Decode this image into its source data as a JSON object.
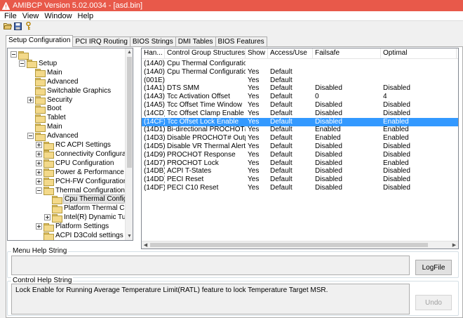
{
  "window": {
    "title": "AMIBCP Version 5.02.0034 - [asd.bin]"
  },
  "menu": [
    "File",
    "View",
    "Window",
    "Help"
  ],
  "toolbar": {
    "open_icon": "folder-open-icon",
    "save_icon": "save-icon",
    "help_icon": "key-icon"
  },
  "tabs": [
    "Setup Configuration",
    "PCI IRQ Routing",
    "BIOS Strings",
    "DMI Tables",
    "BIOS Features"
  ],
  "tree": [
    {
      "label": "",
      "level": 0,
      "exp": "minus"
    },
    {
      "label": "Setup",
      "level": 1,
      "exp": "minus"
    },
    {
      "label": "Main",
      "level": 2,
      "exp": "none"
    },
    {
      "label": "Advanced",
      "level": 2,
      "exp": "none"
    },
    {
      "label": "Switchable Graphics",
      "level": 2,
      "exp": "none"
    },
    {
      "label": "Security",
      "level": 2,
      "exp": "plus"
    },
    {
      "label": "Boot",
      "level": 2,
      "exp": "none"
    },
    {
      "label": "Tablet",
      "level": 2,
      "exp": "none"
    },
    {
      "label": "Main",
      "level": 2,
      "exp": "none"
    },
    {
      "label": "Advanced",
      "level": 2,
      "exp": "minus"
    },
    {
      "label": "RC ACPI Settings",
      "level": 3,
      "exp": "plus"
    },
    {
      "label": "Connectivity Configuration",
      "level": 3,
      "exp": "plus"
    },
    {
      "label": "CPU Configuration",
      "level": 3,
      "exp": "plus"
    },
    {
      "label": "Power & Performance",
      "level": 3,
      "exp": "plus"
    },
    {
      "label": "PCH-FW Configuration",
      "level": 3,
      "exp": "plus"
    },
    {
      "label": "Thermal Configuration",
      "level": 3,
      "exp": "minus"
    },
    {
      "label": "Cpu Thermal Configurat",
      "level": 4,
      "exp": "none",
      "selected": true
    },
    {
      "label": "Platform Thermal Config",
      "level": 4,
      "exp": "none"
    },
    {
      "label": "Intel(R) Dynamic Tuning",
      "level": 4,
      "exp": "plus"
    },
    {
      "label": "Platform Settings",
      "level": 3,
      "exp": "plus"
    },
    {
      "label": "ACPI D3Cold settings",
      "level": 3,
      "exp": "none"
    }
  ],
  "grid": {
    "columns": [
      "Han...",
      "Control Group Structures",
      "Show",
      "Access/Use",
      "Failsafe",
      "Optimal"
    ],
    "rows": [
      [
        "(14A0)",
        "Cpu Thermal Configuration",
        "",
        "",
        "",
        ""
      ],
      [
        "(14A0)",
        "Cpu Thermal Configuration",
        "Yes",
        "Default",
        "",
        ""
      ],
      [
        "(001E)",
        "",
        "Yes",
        "Default",
        "",
        ""
      ],
      [
        "(14A1)",
        "DTS SMM",
        "Yes",
        "Default",
        "Disabled",
        "Disabled"
      ],
      [
        "(14A3)",
        "Tcc Activation Offset",
        "Yes",
        "Default",
        "0",
        "4"
      ],
      [
        "(14A5)",
        "Tcc Offset Time Window",
        "Yes",
        "Default",
        "Disabled",
        "Disabled"
      ],
      [
        "(14CD)",
        "Tcc Offset Clamp Enable",
        "Yes",
        "Default",
        "Disabled",
        "Disabled"
      ],
      [
        "(14CF)",
        "Tcc Offset Lock Enable",
        "Yes",
        "Default",
        "Disabled",
        "Enabled"
      ],
      [
        "(14D1)",
        "Bi-directional PROCHOT#",
        "Yes",
        "Default",
        "Enabled",
        "Enabled"
      ],
      [
        "(14D3)",
        "Disable PROCHOT# Output",
        "Yes",
        "Default",
        "Enabled",
        "Enabled"
      ],
      [
        "(14D5)",
        "Disable VR Thermal Alert",
        "Yes",
        "Default",
        "Disabled",
        "Disabled"
      ],
      [
        "(14D9)",
        "PROCHOT Response",
        "Yes",
        "Default",
        "Disabled",
        "Disabled"
      ],
      [
        "(14D7)",
        "PROCHOT Lock",
        "Yes",
        "Default",
        "Disabled",
        "Enabled"
      ],
      [
        "(14DB)",
        "ACPI T-States",
        "Yes",
        "Default",
        "Disabled",
        "Disabled"
      ],
      [
        "(14DD)",
        "PECI Reset",
        "Yes",
        "Default",
        "Disabled",
        "Disabled"
      ],
      [
        "(14DF)",
        "PECI C10 Reset",
        "Yes",
        "Default",
        "Disabled",
        "Disabled"
      ]
    ],
    "selected_row": 7
  },
  "menu_help": {
    "label": "Menu Help String",
    "text": ""
  },
  "control_help": {
    "label": "Control Help String",
    "text": "Lock Enable for Running Average Temperature Limit(RATL) feature to lock Temperature Target MSR."
  },
  "buttons": {
    "logfile": "LogFile",
    "undo": "Undo"
  }
}
